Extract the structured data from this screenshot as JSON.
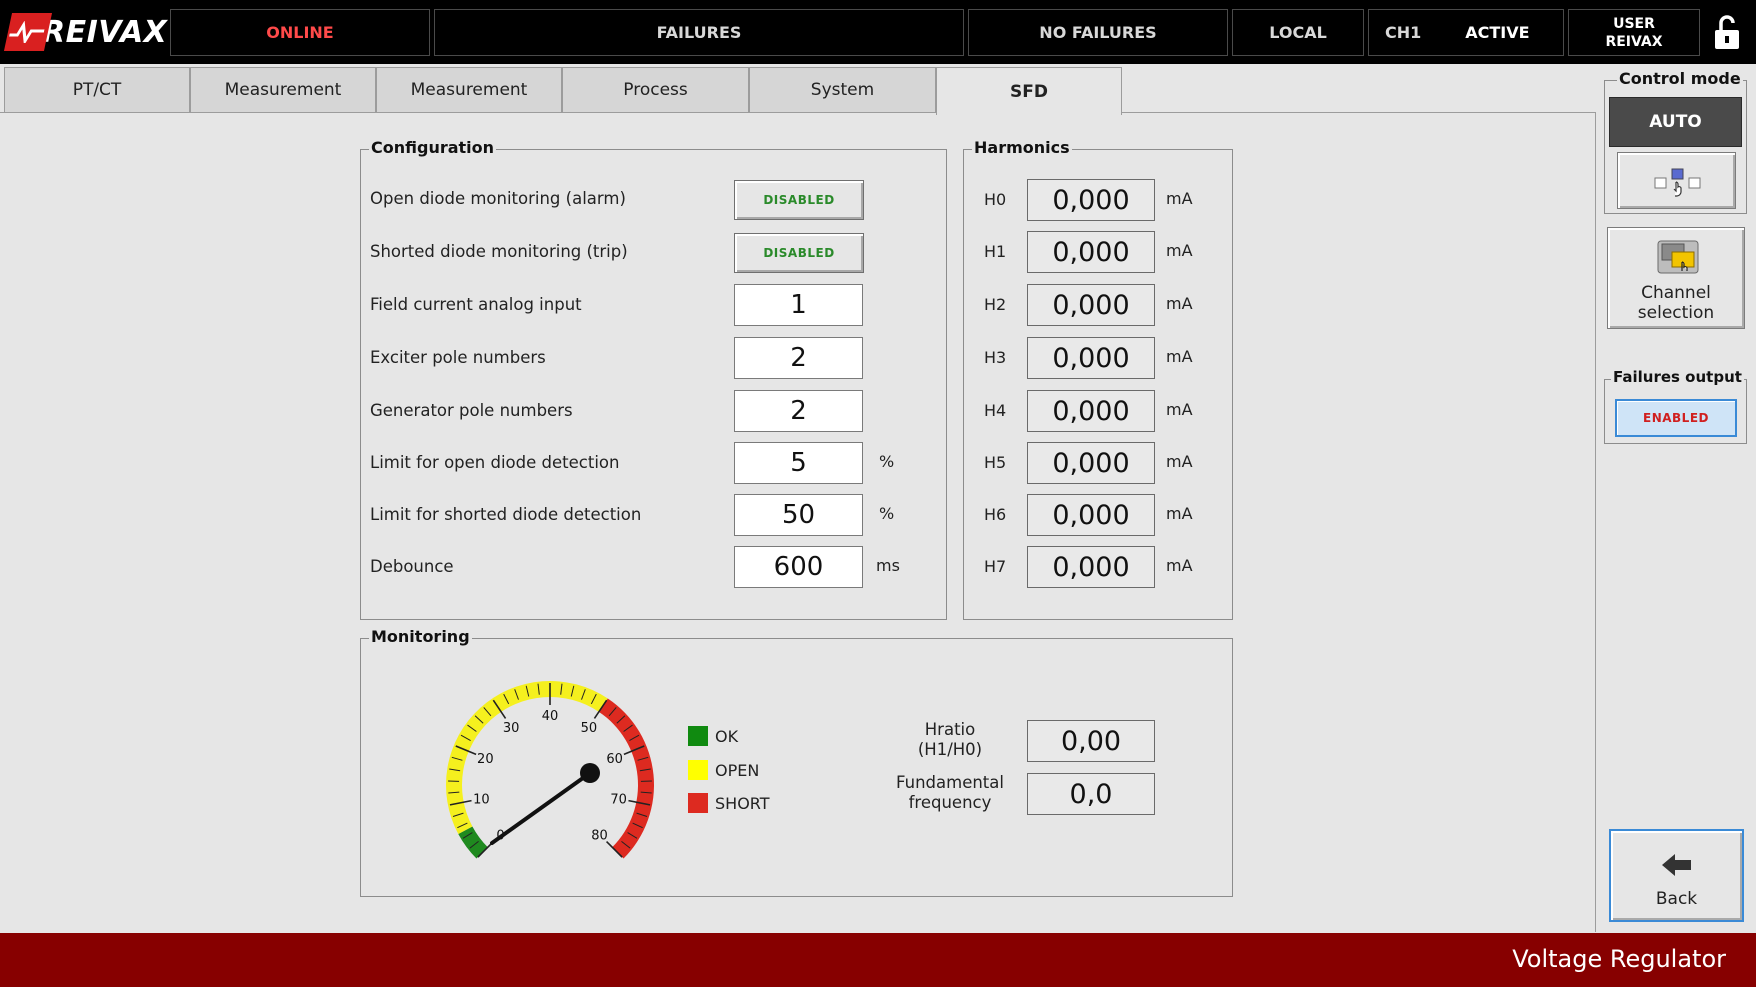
{
  "header": {
    "brand": "REIVAX",
    "status_online": "ONLINE",
    "failures_label": "FAILURES",
    "failures_state": "NO FAILURES",
    "location": "LOCAL",
    "channel": "CH1",
    "channel_state": "ACTIVE",
    "user_line1": "USER",
    "user_line2": "REIVAX"
  },
  "tabs": [
    {
      "label": "PT/CT"
    },
    {
      "label": "Measurement"
    },
    {
      "label": "Measurement"
    },
    {
      "label": "Process"
    },
    {
      "label": "System"
    },
    {
      "label": "SFD",
      "active": true
    }
  ],
  "configuration": {
    "title": "Configuration",
    "open_diode": {
      "label": "Open diode monitoring (alarm)",
      "state": "DISABLED"
    },
    "shorted_diode": {
      "label": "Shorted diode monitoring (trip)",
      "state": "DISABLED"
    },
    "field_current": {
      "label": "Field current analog input",
      "value": "1"
    },
    "exciter_poles": {
      "label": "Exciter pole numbers",
      "value": "2"
    },
    "generator_poles": {
      "label": "Generator pole numbers",
      "value": "2"
    },
    "open_limit": {
      "label": "Limit for open diode detection",
      "value": "5",
      "unit": "%"
    },
    "shorted_limit": {
      "label": "Limit for shorted diode detection",
      "value": "50",
      "unit": "%"
    },
    "debounce": {
      "label": "Debounce",
      "value": "600",
      "unit": "ms"
    }
  },
  "harmonics": {
    "title": "Harmonics",
    "items": [
      {
        "label": "H0",
        "value": "0,000",
        "unit": "mA"
      },
      {
        "label": "H1",
        "value": "0,000",
        "unit": "mA"
      },
      {
        "label": "H2",
        "value": "0,000",
        "unit": "mA"
      },
      {
        "label": "H3",
        "value": "0,000",
        "unit": "mA"
      },
      {
        "label": "H4",
        "value": "0,000",
        "unit": "mA"
      },
      {
        "label": "H5",
        "value": "0,000",
        "unit": "mA"
      },
      {
        "label": "H6",
        "value": "0,000",
        "unit": "mA"
      },
      {
        "label": "H7",
        "value": "0,000",
        "unit": "mA"
      }
    ]
  },
  "monitoring": {
    "title": "Monitoring",
    "gauge": {
      "value": 0,
      "min": 0,
      "max": 80,
      "tick_labels": [
        "0",
        "10",
        "20",
        "30",
        "40",
        "50",
        "60",
        "70",
        "80"
      ],
      "zones": [
        {
          "from": 0,
          "to": 5,
          "color": "#1f8a1f"
        },
        {
          "from": 5,
          "to": 50,
          "color": "#f5f01e"
        },
        {
          "from": 50,
          "to": 80,
          "color": "#dd2a20"
        }
      ]
    },
    "legend": [
      {
        "label": "OK",
        "color": "#108a10"
      },
      {
        "label": "OPEN",
        "color": "#ffff00"
      },
      {
        "label": "SHORT",
        "color": "#dd2a20"
      }
    ],
    "hratio": {
      "label_line1": "Hratio",
      "label_line2": "(H1/H0)",
      "value": "0,00"
    },
    "fundamental": {
      "label_line1": "Fundamental",
      "label_line2": "frequency",
      "value": "0,0"
    }
  },
  "right_panel": {
    "control_mode_title": "Control mode",
    "control_mode_value": "AUTO",
    "channel_selection_line1": "Channel",
    "channel_selection_line2": "selection",
    "failures_output_title": "Failures output",
    "failures_output_state": "ENABLED",
    "back_label": "Back"
  },
  "footer": {
    "title": "Voltage Regulator"
  },
  "icons": [
    "reivax-logo-icon",
    "unlock-icon",
    "control-mode-icon",
    "channel-selection-icon",
    "back-arrow-icon"
  ],
  "colors": {
    "header_bg": "#000000",
    "footer_bg": "#870000",
    "online": "#ff4a4a",
    "disabled_text": "#2a8a2a",
    "enabled_text": "#d02020"
  }
}
